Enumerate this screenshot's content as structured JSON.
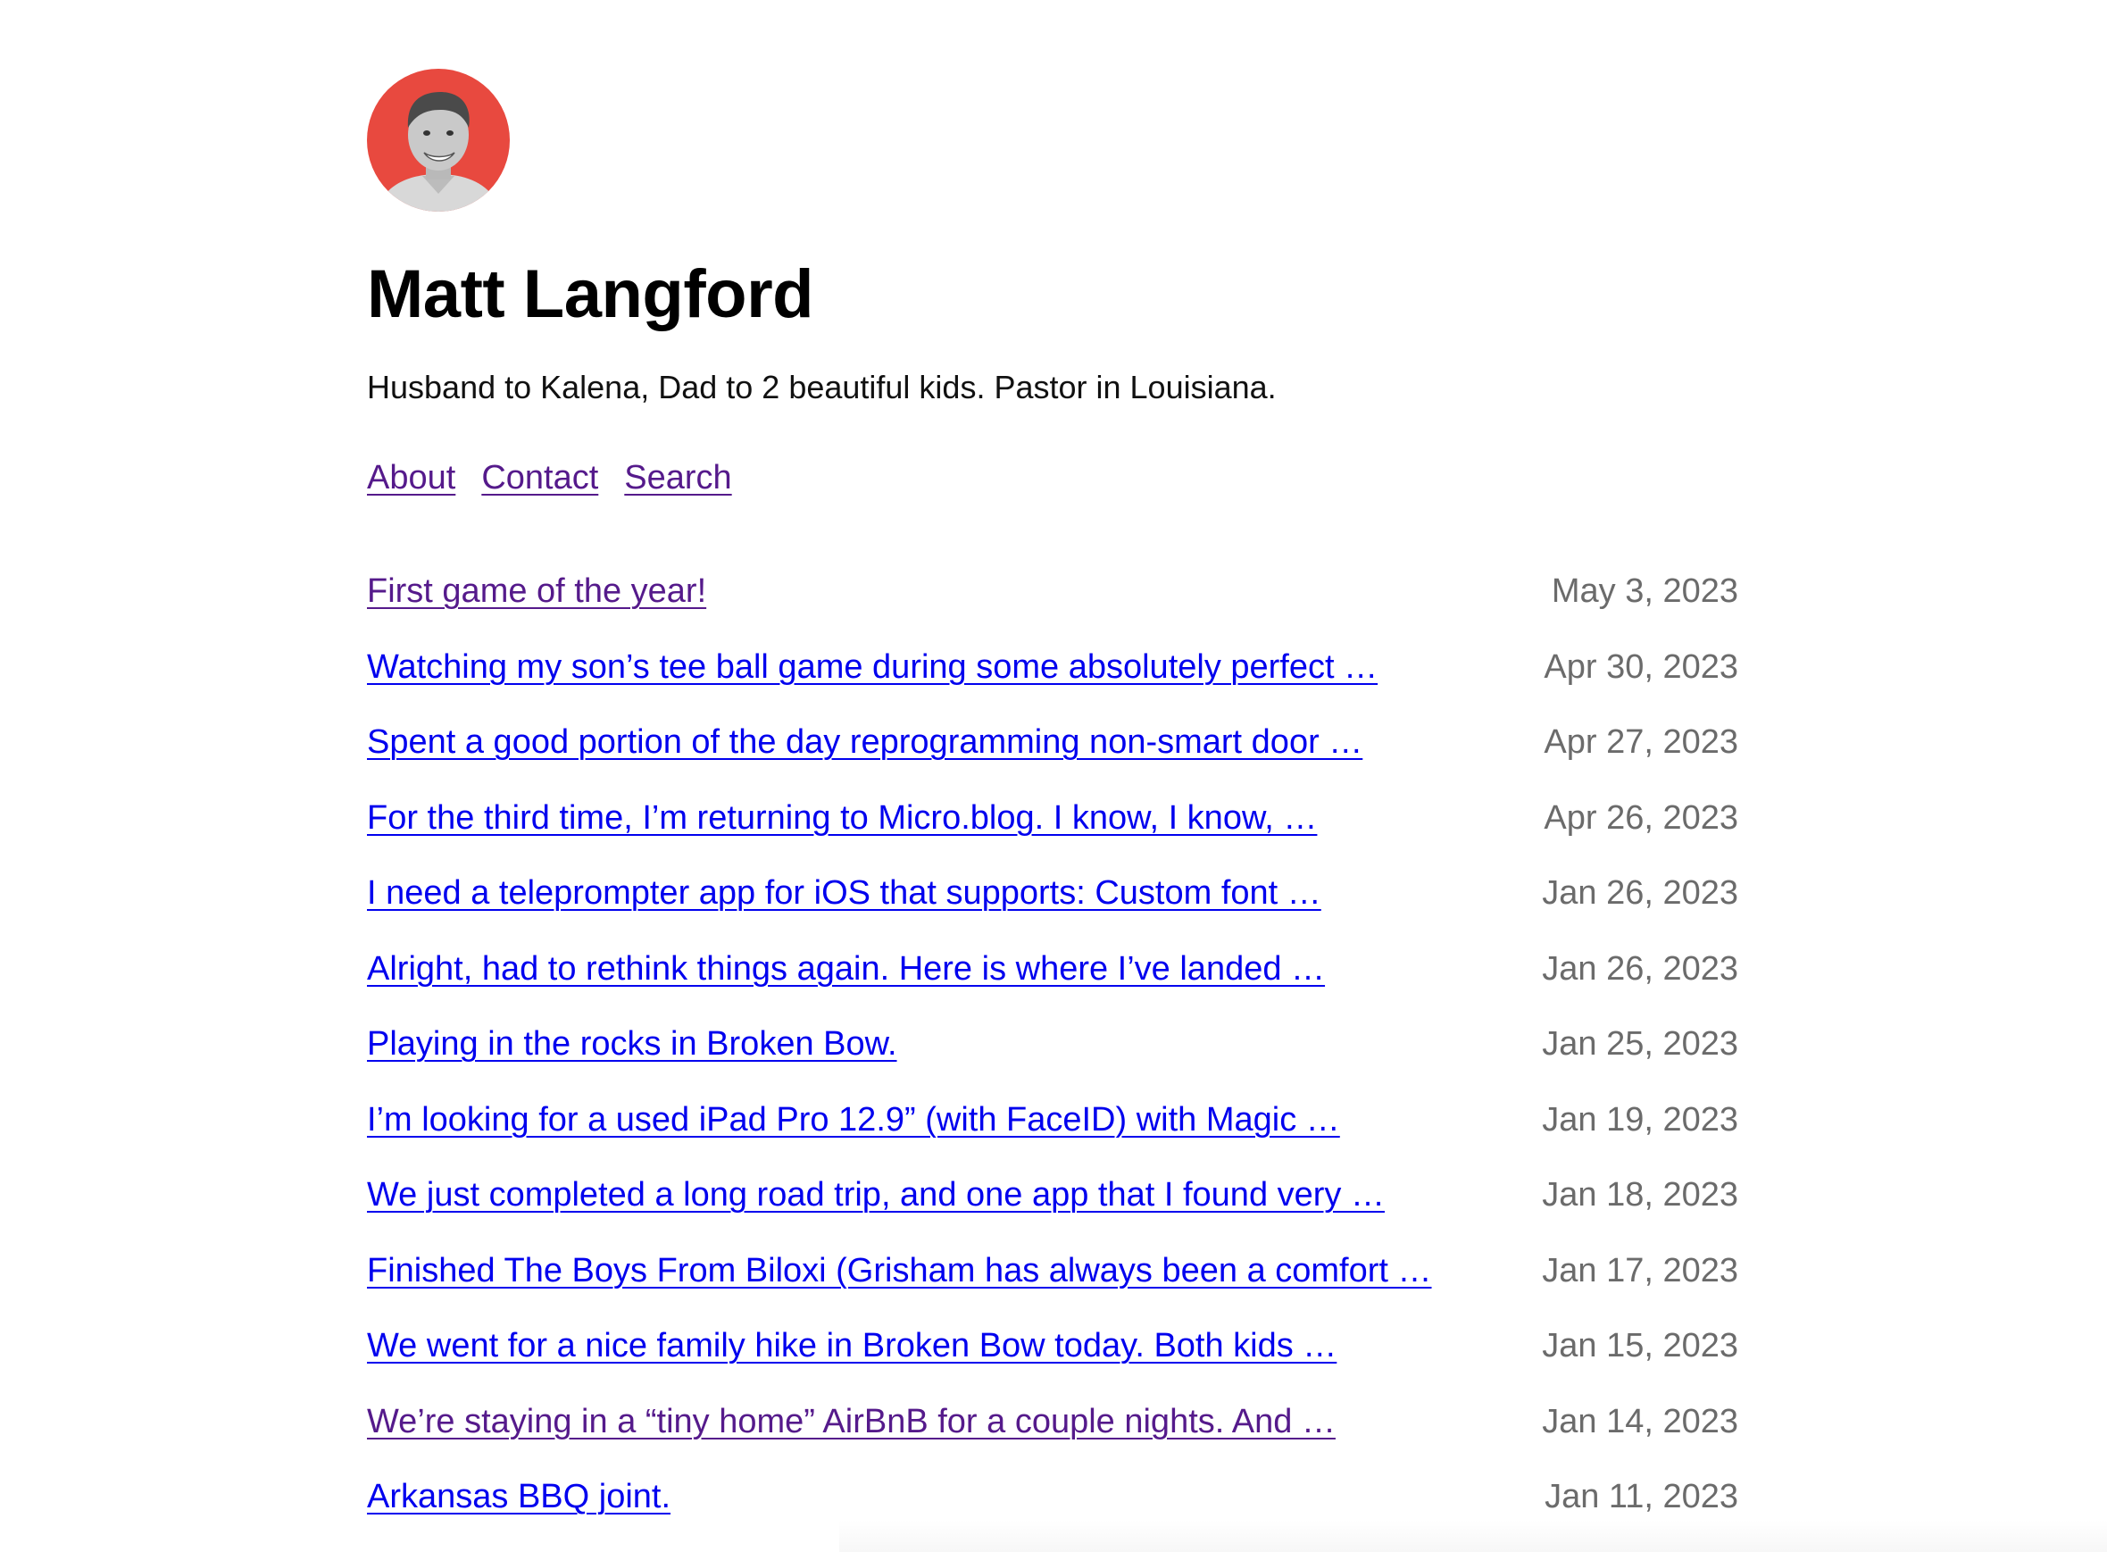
{
  "header": {
    "avatar_alt": "Matt Langford",
    "title": "Matt Langford",
    "bio": "Husband to Kalena, Dad to 2 beautiful kids. Pastor in Louisiana."
  },
  "nav": [
    {
      "label": "About"
    },
    {
      "label": "Contact"
    },
    {
      "label": "Search"
    }
  ],
  "posts": [
    {
      "title": "First game of the year!",
      "date": "May 3, 2023",
      "visited": true
    },
    {
      "title": "Watching my son’s tee ball game during some absolutely perfect …",
      "date": "Apr 30, 2023",
      "visited": false
    },
    {
      "title": "Spent a good portion of the day reprogramming non-smart door …",
      "date": "Apr 27, 2023",
      "visited": false
    },
    {
      "title": "For the third time, I’m returning to Micro.blog. I know, I know, …",
      "date": "Apr 26, 2023",
      "visited": false
    },
    {
      "title": "I need a teleprompter app for iOS that supports: Custom font …",
      "date": "Jan 26, 2023",
      "visited": false
    },
    {
      "title": "Alright, had to rethink things again. Here is where I’ve landed …",
      "date": "Jan 26, 2023",
      "visited": false
    },
    {
      "title": "Playing in the rocks in Broken Bow.",
      "date": "Jan 25, 2023",
      "visited": false
    },
    {
      "title": "I’m looking for a used iPad Pro 12.9” (with FaceID) with Magic …",
      "date": "Jan 19, 2023",
      "visited": false
    },
    {
      "title": "We just completed a long road trip, and one app that I found very …",
      "date": "Jan 18, 2023",
      "visited": false
    },
    {
      "title": "Finished The Boys From Biloxi (Grisham has always been a comfort …",
      "date": "Jan 17, 2023",
      "visited": false
    },
    {
      "title": "We went for a nice family hike in Broken Bow today. Both kids …",
      "date": "Jan 15, 2023",
      "visited": false
    },
    {
      "title": "We’re staying in a “tiny home” AirBnB for a couple nights. And …",
      "date": "Jan 14, 2023",
      "visited": true
    },
    {
      "title": "Arkansas BBQ joint.",
      "date": "Jan 11, 2023",
      "visited": false
    }
  ],
  "colors": {
    "link": "#0000ee",
    "visited_link": "#551a8b",
    "date": "#6b6b6b",
    "avatar_bg": "#e8493f"
  }
}
